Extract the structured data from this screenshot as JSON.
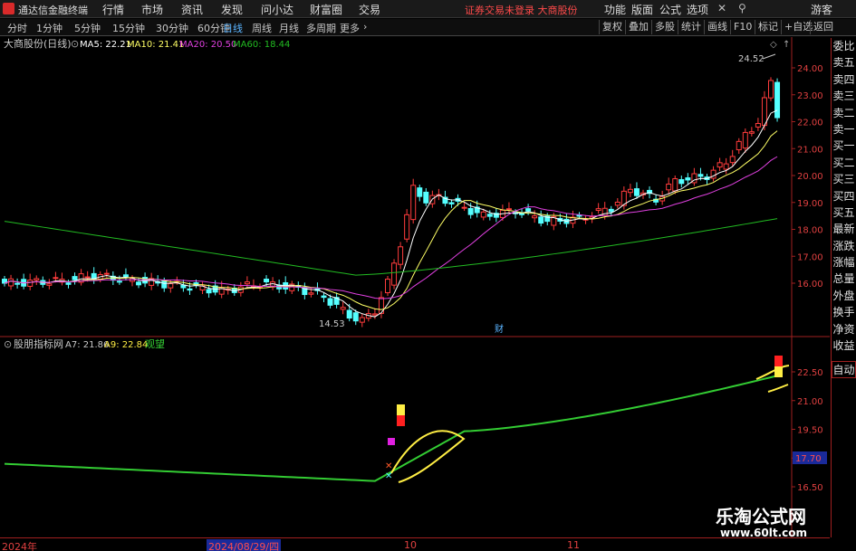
{
  "menubar": {
    "app_title": "通达信金融终端",
    "items": [
      "行情",
      "市场",
      "资讯",
      "发现",
      "问小达",
      "财富圈",
      "交易"
    ],
    "alert": "证券交易未登录  大商股份",
    "right_items": [
      "功能",
      "版面",
      "公式",
      "选项"
    ],
    "guest": "游客"
  },
  "tabbar": {
    "periods": [
      "分时",
      "1分钟",
      "5分钟",
      "15分钟",
      "30分钟",
      "60分钟",
      "日线",
      "周线",
      "月线",
      "多周期",
      "更多"
    ],
    "active_period": "日线",
    "right_buttons": [
      "复权",
      "叠加",
      "多股",
      "统计",
      "画线",
      "F10",
      "标记",
      "+自选",
      "返回"
    ]
  },
  "main_panel": {
    "stock_name": "大商股份(日线)",
    "ma5": "MA5: 22.21",
    "ma10": "MA10: 21.41",
    "ma20": "MA20: 20.50",
    "ma60": "MA60: 18.44",
    "high_label": "24.52",
    "low_label": "14.53",
    "cai_marker": "财",
    "y_ticks": [
      "24.00",
      "23.00",
      "22.00",
      "21.00",
      "20.00",
      "19.00",
      "18.00",
      "17.00",
      "16.00"
    ]
  },
  "sub_panel": {
    "name": "股朋指标网",
    "a7": "A7: 21.86",
    "a9": "A9: 22.84",
    "status": "观望",
    "y_ticks": [
      "22.50",
      "21.00",
      "19.50",
      "18.00",
      "16.50"
    ],
    "current_value": "17.70"
  },
  "right_panel": [
    "委比",
    "卖五",
    "卖四",
    "卖三",
    "卖二",
    "卖一",
    "买一",
    "买二",
    "买三",
    "买四",
    "买五",
    "最新",
    "涨跌",
    "涨幅",
    "总量",
    "外盘",
    "换手",
    "净资",
    "收益",
    "自动"
  ],
  "time_axis": {
    "labels": [
      "2024年",
      "2024/08/29/四",
      "10",
      "11"
    ]
  },
  "watermark": {
    "line1": "乐淘公式网",
    "line2": "www.60lt.com"
  },
  "colors": {
    "up": "#ff3c3c",
    "down": "#54ffff",
    "ma5": "#ffffff",
    "ma10": "#ffff66",
    "ma20": "#e040e0",
    "ma60": "#22bb22",
    "grid": "#a02020",
    "indicator_green": "#33cc33",
    "indicator_yellow": "#ffee44"
  }
}
